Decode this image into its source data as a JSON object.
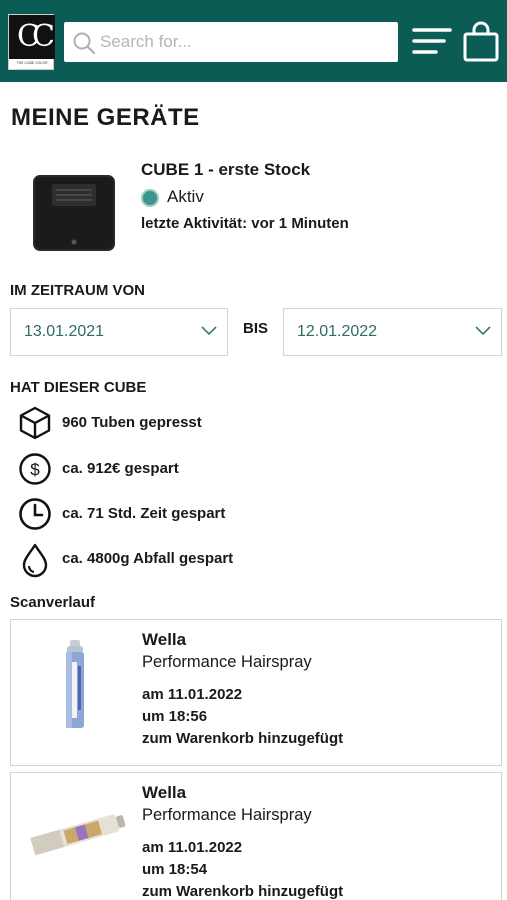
{
  "header": {
    "brand": "CC",
    "brand_subline": "THE CUBE COLOR",
    "search_placeholder": "Search for..."
  },
  "page_title": "MEINE GERÄTE",
  "device": {
    "name": "CUBE 1 - erste Stock",
    "status": "Aktiv",
    "last_activity": "letzte Aktivität: vor 1 Minuten"
  },
  "period": {
    "label": "IM ZEITRAUM VON",
    "from": "13.01.2021",
    "to_label": "BIS",
    "to": "12.01.2022"
  },
  "stats": {
    "label": "HAT DIESER CUBE",
    "items": [
      {
        "icon": "cube-icon",
        "text": "960  Tuben gepresst"
      },
      {
        "icon": "dollar-icon",
        "text": "ca. 912€ gespart"
      },
      {
        "icon": "clock-icon",
        "text": "ca. 71 Std. Zeit gespart"
      },
      {
        "icon": "drop-icon",
        "text": "ca. 4800g Abfall gespart"
      }
    ]
  },
  "history": {
    "label": "Scanverlauf",
    "entries": [
      {
        "brand": "Wella",
        "product": "Performance Hairspray",
        "date": "am 11.01.2022",
        "time": "um 18:56",
        "action": "zum Warenkorb hinzugefügt"
      },
      {
        "brand": "Wella",
        "product": "Performance Hairspray",
        "date": "am 11.01.2022",
        "time": "um 18:54",
        "action": "zum Warenkorb hinzugefügt"
      }
    ]
  },
  "colors": {
    "header_bg": "#0b5c55",
    "accent": "#2c6e67",
    "status_active": "#3a958d"
  }
}
